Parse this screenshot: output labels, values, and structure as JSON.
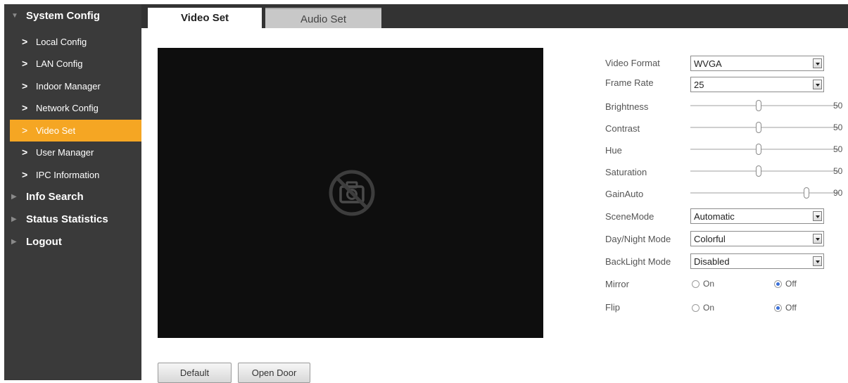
{
  "sidebar": {
    "groups": [
      {
        "label": "System Config"
      },
      {
        "label": "Info Search"
      },
      {
        "label": "Status Statistics"
      },
      {
        "label": "Logout"
      }
    ],
    "items": [
      {
        "label": "Local Config"
      },
      {
        "label": "LAN Config"
      },
      {
        "label": "Indoor Manager"
      },
      {
        "label": "Network Config"
      },
      {
        "label": "Video Set"
      },
      {
        "label": "User Manager"
      },
      {
        "label": "IPC Information"
      }
    ],
    "active_item": "Video Set",
    "active_color": "#f5a623"
  },
  "tabs": [
    {
      "label": "Video Set",
      "active": true
    },
    {
      "label": "Audio Set",
      "active": false
    }
  ],
  "preview": {
    "icon": "camera-disabled-icon"
  },
  "buttons": {
    "default_label": "Default",
    "open_door_label": "Open Door"
  },
  "settings": {
    "video_format": {
      "label": "Video Format",
      "value": "WVGA"
    },
    "frame_rate": {
      "label": "Frame Rate",
      "value": "25"
    },
    "brightness": {
      "label": "Brightness",
      "value": "50",
      "max": "100"
    },
    "contrast": {
      "label": "Contrast",
      "value": "50",
      "max": "100"
    },
    "hue": {
      "label": "Hue",
      "value": "50",
      "max": "100"
    },
    "saturation": {
      "label": "Saturation",
      "value": "50",
      "max": "100"
    },
    "gain_auto": {
      "label": "GainAuto",
      "value": "90",
      "max": "100"
    },
    "scene_mode": {
      "label": "SceneMode",
      "value": "Automatic"
    },
    "day_night_mode": {
      "label": "Day/Night Mode",
      "value": "Colorful"
    },
    "backlight_mode": {
      "label": "BackLight Mode",
      "value": "Disabled"
    },
    "mirror": {
      "label": "Mirror",
      "on_label": "On",
      "off_label": "Off",
      "selected": "Off"
    },
    "flip": {
      "label": "Flip",
      "on_label": "On",
      "off_label": "Off",
      "selected": "Off"
    }
  }
}
